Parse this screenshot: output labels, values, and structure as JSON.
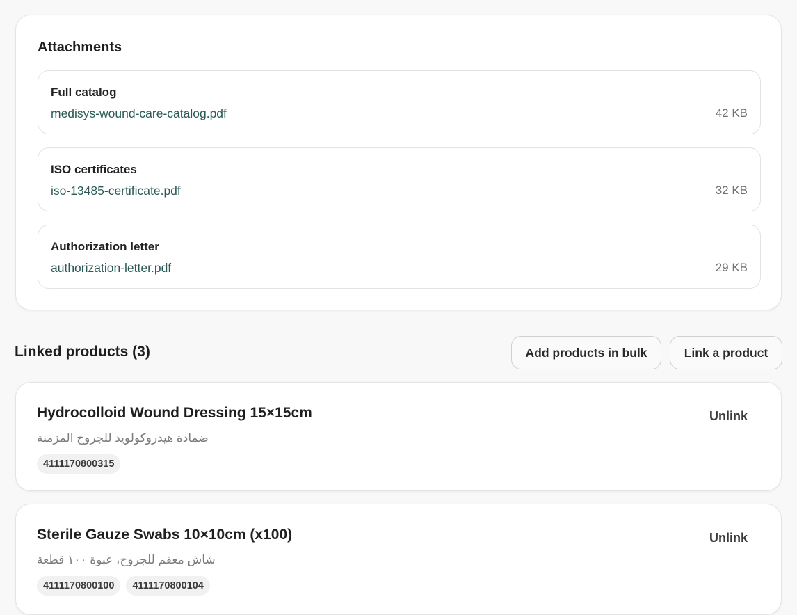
{
  "attachments": {
    "title": "Attachments",
    "items": [
      {
        "label": "Full catalog",
        "file": "medisys-wound-care-catalog.pdf",
        "size": "42 KB"
      },
      {
        "label": "ISO certificates",
        "file": "iso-13485-certificate.pdf",
        "size": "32 KB"
      },
      {
        "label": "Authorization letter",
        "file": "authorization-letter.pdf",
        "size": "29 KB"
      }
    ]
  },
  "linked_products": {
    "title": "Linked products (3)",
    "add_bulk_label": "Add products in bulk",
    "link_label": "Link a product",
    "unlink_label": "Unlink",
    "items": [
      {
        "name": "Hydrocolloid Wound Dressing 15×15cm",
        "arabic": "ضمادة هيدروكولويد للجروح المزمنة",
        "barcodes": [
          "4111170800315"
        ]
      },
      {
        "name": "Sterile Gauze Swabs 10×10cm (x100)",
        "arabic": "شاش معقم للجروح، عبوة ١٠٠ قطعة",
        "barcodes": [
          "4111170800100",
          "4111170800104"
        ]
      }
    ]
  },
  "colors": {
    "link_text": "#2a5a56",
    "page_background": "#f8f8f8",
    "card_background": "#ffffff"
  }
}
